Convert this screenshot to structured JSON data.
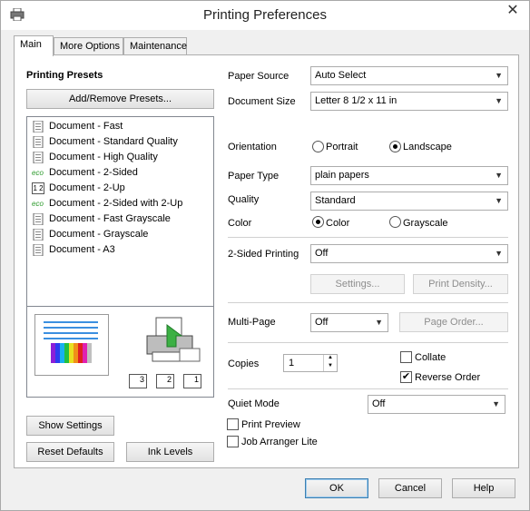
{
  "window": {
    "title": "Printing Preferences",
    "close_glyph": "✕"
  },
  "tabs": [
    {
      "label": "Main"
    },
    {
      "label": "More Options"
    },
    {
      "label": "Maintenance"
    }
  ],
  "presets": {
    "heading": "Printing Presets",
    "add_remove_label": "Add/Remove Presets...",
    "items": [
      {
        "label": "Document - Fast",
        "icon": "document-icon"
      },
      {
        "label": "Document - Standard Quality",
        "icon": "document-icon"
      },
      {
        "label": "Document - High Quality",
        "icon": "document-icon"
      },
      {
        "label": "Document - 2-Sided",
        "icon": "eco-icon"
      },
      {
        "label": "Document - 2-Up",
        "icon": "two-up-icon"
      },
      {
        "label": "Document - 2-Sided with 2-Up",
        "icon": "eco-icon"
      },
      {
        "label": "Document - Fast Grayscale",
        "icon": "document-icon"
      },
      {
        "label": "Document - Grayscale",
        "icon": "document-icon"
      },
      {
        "label": "Document - A3",
        "icon": "document-icon"
      }
    ],
    "eco_text": "eco",
    "two_up_text": "1 2",
    "collate_icons": [
      "3",
      "2",
      "1"
    ]
  },
  "left_buttons": {
    "show_settings": "Show Settings",
    "reset_defaults": "Reset Defaults",
    "ink_levels": "Ink Levels"
  },
  "settings": {
    "paper_source": {
      "label": "Paper Source",
      "value": "Auto Select"
    },
    "document_size": {
      "label": "Document Size",
      "value": "Letter 8 1/2 x 11 in"
    },
    "orientation": {
      "label": "Orientation",
      "options": [
        "Portrait",
        "Landscape"
      ],
      "selected": "Landscape"
    },
    "paper_type": {
      "label": "Paper Type",
      "value": "plain papers"
    },
    "quality": {
      "label": "Quality",
      "value": "Standard"
    },
    "color": {
      "label": "Color",
      "options": [
        "Color",
        "Grayscale"
      ],
      "selected": "Color"
    },
    "two_sided": {
      "label": "2-Sided Printing",
      "value": "Off",
      "settings_button": "Settings...",
      "density_button": "Print Density..."
    },
    "multi_page": {
      "label": "Multi-Page",
      "value": "Off",
      "page_order_button": "Page Order..."
    },
    "copies": {
      "label": "Copies",
      "value": "1"
    },
    "collate": {
      "label": "Collate",
      "checked": false
    },
    "reverse_order": {
      "label": "Reverse Order",
      "checked": true
    },
    "quiet_mode": {
      "label": "Quiet Mode",
      "value": "Off"
    },
    "print_preview": {
      "label": "Print Preview",
      "checked": false
    },
    "job_arranger": {
      "label": "Job Arranger Lite",
      "checked": false
    }
  },
  "footer": {
    "ok": "OK",
    "cancel": "Cancel",
    "help": "Help"
  },
  "glyphs": {
    "dropdown": "▼",
    "spin_up": "▲",
    "spin_down": "▼",
    "check": "✔"
  },
  "colors": {
    "accent_blue": "#3c7fb1",
    "preview_lines": "#3b8fe0",
    "printer_arrow": "#3cb044"
  }
}
